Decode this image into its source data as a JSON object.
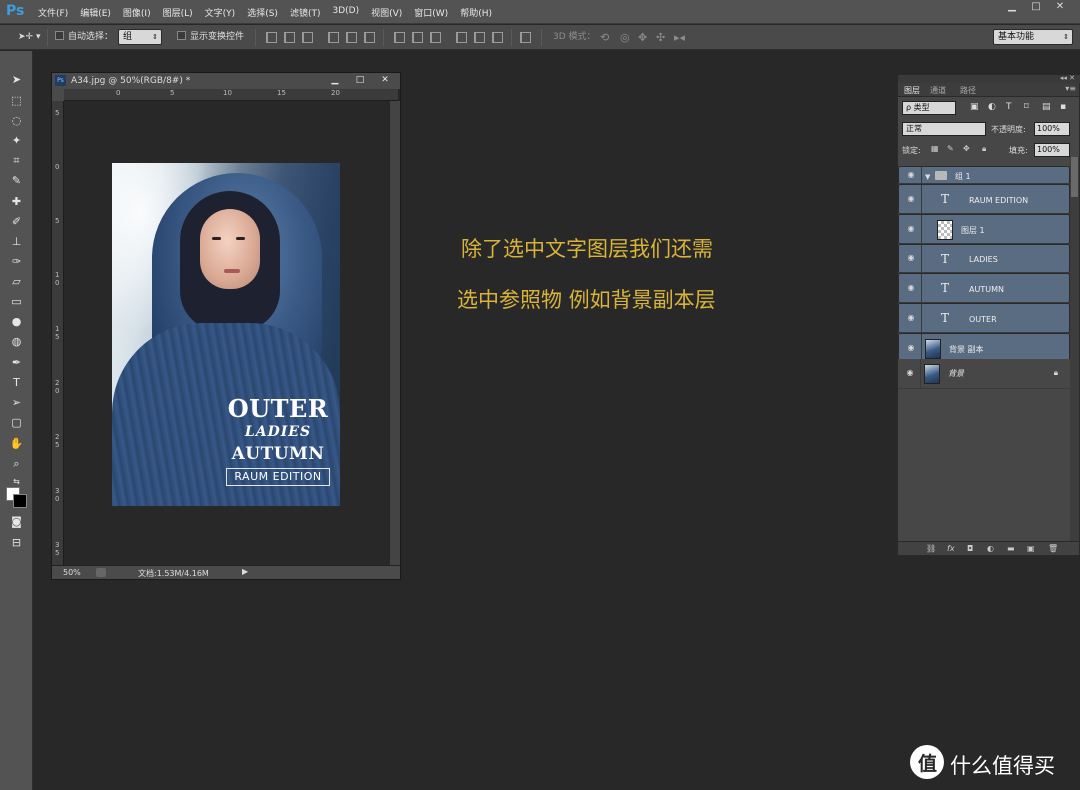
{
  "app": {
    "logo": "Ps"
  },
  "menu": [
    "文件(F)",
    "编辑(E)",
    "图像(I)",
    "图层(L)",
    "文字(Y)",
    "选择(S)",
    "滤镜(T)",
    "3D(D)",
    "视图(V)",
    "窗口(W)",
    "帮助(H)"
  ],
  "window_controls": {
    "minimize": "▁",
    "maximize": "□",
    "close": "✕"
  },
  "options": {
    "auto_select_label": "自动选择：",
    "auto_select_value": "组",
    "show_transform_label": "显示变换控件",
    "mode_3d_label": "3D 模式：",
    "workspace_value": "基本功能"
  },
  "document": {
    "title": "A34.jpg @ 50%(RGB/8#) *",
    "zoom": "50%",
    "doc_info": "文档:1.53M/4.16M",
    "ruler_h": [
      "0",
      "5",
      "10",
      "15",
      "20"
    ],
    "ruler_v": [
      "5",
      "0",
      "5",
      "1",
      "0",
      "1",
      "5",
      "2",
      "0",
      "2",
      "5",
      "3",
      "0",
      "3",
      "5"
    ]
  },
  "poster": {
    "outer": "OUTER",
    "ladies": "LADIES",
    "autumn": "AUTUMN",
    "raum": "RAUM EDITION"
  },
  "annotation": {
    "line1": "除了选中文字图层我们还需",
    "line2": "选中参照物 例如背景副本层"
  },
  "layers_panel": {
    "tabs": [
      "图层",
      "通道",
      "路径"
    ],
    "filter_value": "ρ 类型",
    "blend_mode": "正常",
    "opacity_label": "不透明度:",
    "opacity_value": "100%",
    "lock_label": "锁定:",
    "fill_label": "填充:",
    "fill_value": "100%",
    "layers": [
      {
        "name": "组 1",
        "kind": "group",
        "selected": true
      },
      {
        "name": "RAUM EDITION",
        "kind": "text",
        "selected": true
      },
      {
        "name": "图层 1",
        "kind": "pixel",
        "selected": true
      },
      {
        "name": "LADIES",
        "kind": "text",
        "selected": true
      },
      {
        "name": "AUTUMN",
        "kind": "text",
        "selected": true
      },
      {
        "name": "OUTER",
        "kind": "text",
        "selected": true
      },
      {
        "name": "背景 副本",
        "kind": "photo",
        "selected": true
      },
      {
        "name": "背景",
        "kind": "photo",
        "selected": false,
        "locked": true
      }
    ]
  },
  "watermark": {
    "badge": "值",
    "text": "什么值得买"
  },
  "colors": {
    "accent_annotation": "#d8b43a",
    "selected_layer": "#5a6c82",
    "ps_blue": "#3d9ddf"
  }
}
